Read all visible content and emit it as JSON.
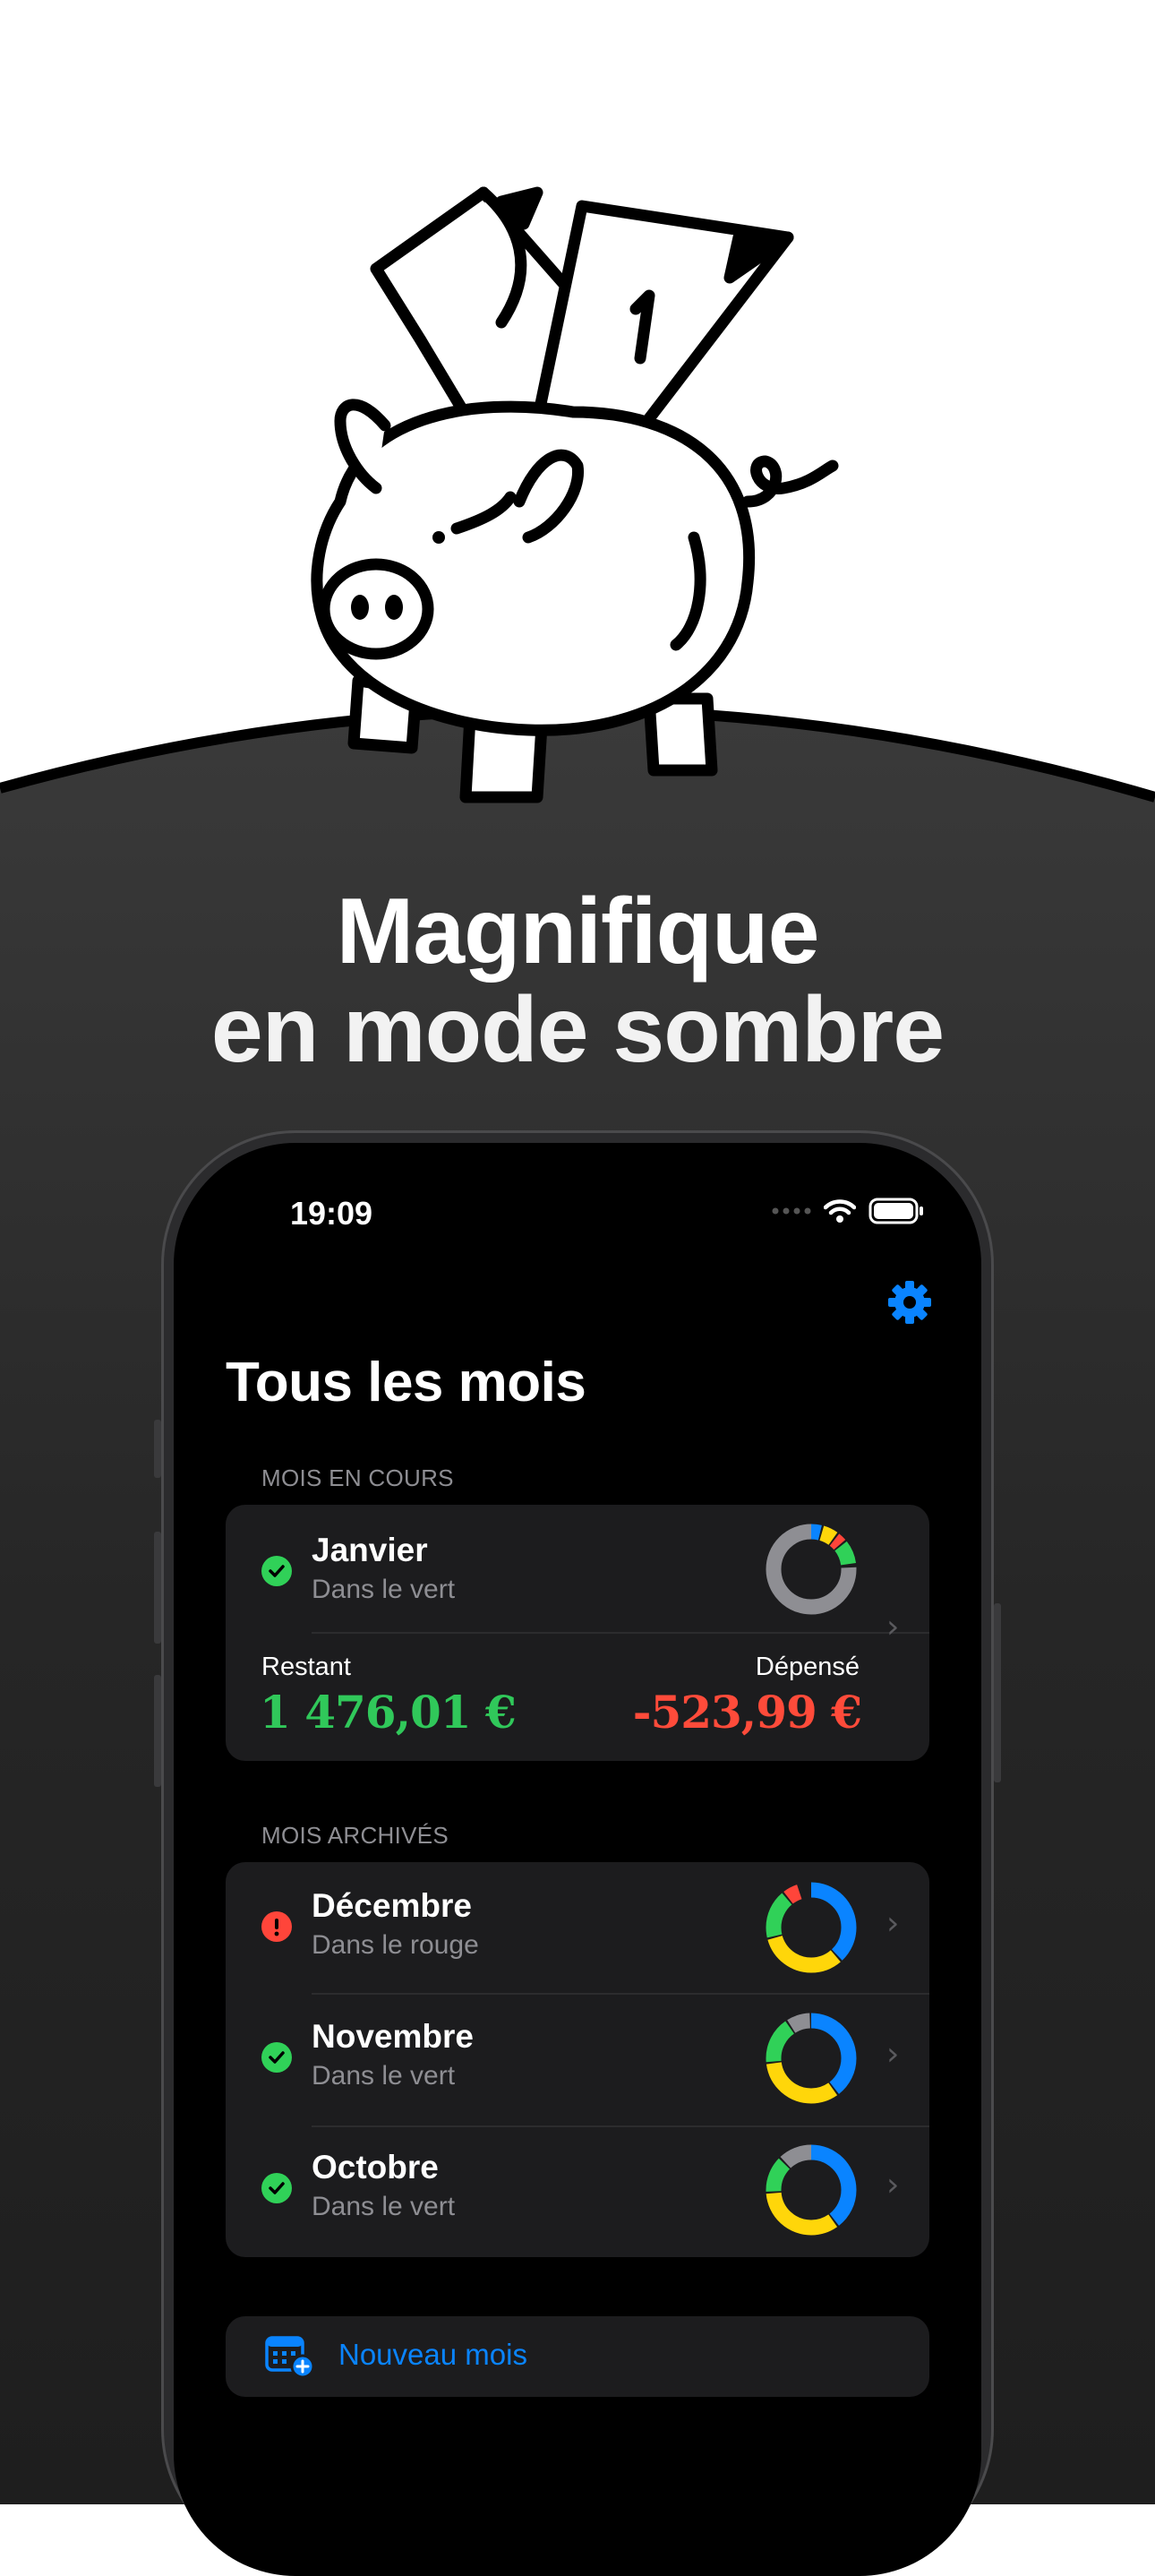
{
  "headline": {
    "line1": "Magnifique",
    "line2": "en mode sombre"
  },
  "status_bar": {
    "time": "19:09"
  },
  "page": {
    "title": "Tous les mois"
  },
  "current": {
    "section_label": "MOIS EN COURS",
    "month": "Janvier",
    "status": "Dans le vert",
    "remaining_label": "Restant",
    "remaining_value": "1 476,01 €",
    "spent_label": "Dépensé",
    "spent_value": "-523,99 €"
  },
  "archived": {
    "section_label": "MOIS ARCHIVÉS",
    "items": [
      {
        "month": "Décembre",
        "status": "Dans le rouge",
        "state": "warning"
      },
      {
        "month": "Novembre",
        "status": "Dans le vert",
        "state": "ok"
      },
      {
        "month": "Octobre",
        "status": "Dans le vert",
        "state": "ok"
      }
    ]
  },
  "new_month": {
    "label": "Nouveau mois"
  },
  "colors": {
    "accent": "#0a84ff",
    "green": "#30d158",
    "red": "#ff453a",
    "positive_amount": "#30c85a",
    "negative_amount": "#ff4b3a"
  },
  "icons": [
    "piggy-bank-illustration",
    "wifi-icon",
    "battery-icon",
    "signal-dots-icon",
    "gear-icon",
    "checkmark-circle-icon",
    "exclamation-circle-icon",
    "chevron-right-icon",
    "donut-chart-icon",
    "calendar-plus-icon"
  ]
}
